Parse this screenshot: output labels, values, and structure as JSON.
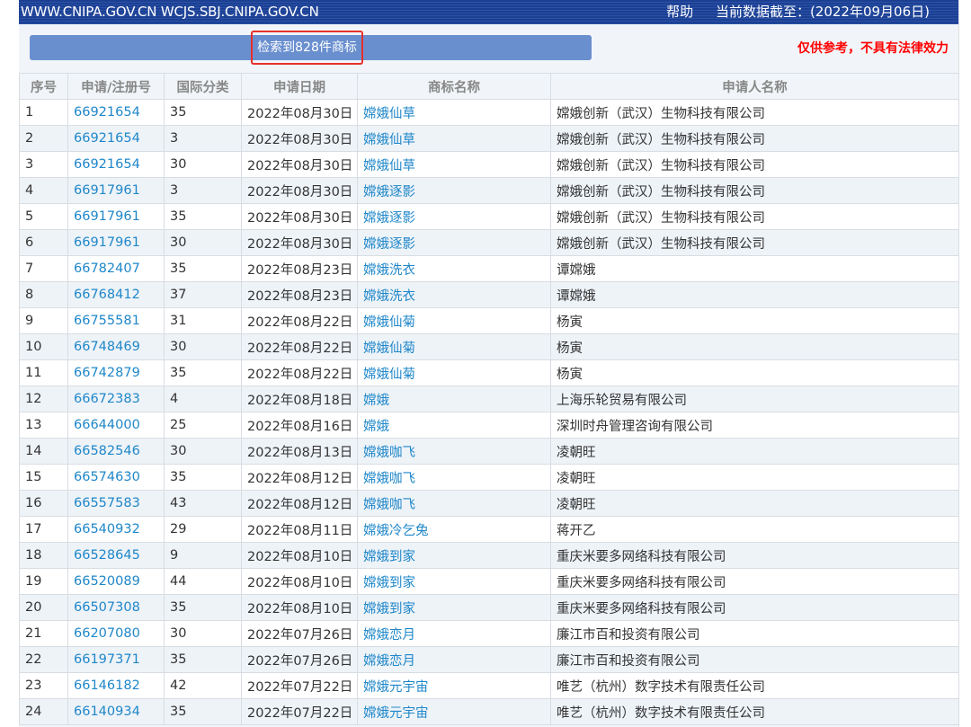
{
  "header": {
    "sites": "WWW.CNIPA.GOV.CN WCJS.SBJ.CNIPA.GOV.CN",
    "help": "帮助",
    "data_cutoff": "当前数据截至：(2022年09月06日)"
  },
  "search": {
    "result_count": "检索到828件商标",
    "disclaimer": "仅供参考，不具有法律效力"
  },
  "table": {
    "columns": [
      "序号",
      "申请/注册号",
      "国际分类",
      "申请日期",
      "商标名称",
      "申请人名称"
    ],
    "rows": [
      {
        "no": "1",
        "reg": "66921654",
        "cls": "35",
        "date": "2022年08月30日",
        "mark": "嫦娥仙草",
        "applicant": "嫦娥创新（武汉）生物科技有限公司"
      },
      {
        "no": "2",
        "reg": "66921654",
        "cls": "3",
        "date": "2022年08月30日",
        "mark": "嫦娥仙草",
        "applicant": "嫦娥创新（武汉）生物科技有限公司"
      },
      {
        "no": "3",
        "reg": "66921654",
        "cls": "30",
        "date": "2022年08月30日",
        "mark": "嫦娥仙草",
        "applicant": "嫦娥创新（武汉）生物科技有限公司"
      },
      {
        "no": "4",
        "reg": "66917961",
        "cls": "3",
        "date": "2022年08月30日",
        "mark": "嫦娥逐影",
        "applicant": "嫦娥创新（武汉）生物科技有限公司"
      },
      {
        "no": "5",
        "reg": "66917961",
        "cls": "35",
        "date": "2022年08月30日",
        "mark": "嫦娥逐影",
        "applicant": "嫦娥创新（武汉）生物科技有限公司"
      },
      {
        "no": "6",
        "reg": "66917961",
        "cls": "30",
        "date": "2022年08月30日",
        "mark": "嫦娥逐影",
        "applicant": "嫦娥创新（武汉）生物科技有限公司"
      },
      {
        "no": "7",
        "reg": "66782407",
        "cls": "35",
        "date": "2022年08月23日",
        "mark": "嫦娥洗衣",
        "applicant": "谭嫦娥"
      },
      {
        "no": "8",
        "reg": "66768412",
        "cls": "37",
        "date": "2022年08月23日",
        "mark": "嫦娥洗衣",
        "applicant": "谭嫦娥"
      },
      {
        "no": "9",
        "reg": "66755581",
        "cls": "31",
        "date": "2022年08月22日",
        "mark": "嫦娥仙菊",
        "applicant": "杨寅"
      },
      {
        "no": "10",
        "reg": "66748469",
        "cls": "30",
        "date": "2022年08月22日",
        "mark": "嫦娥仙菊",
        "applicant": "杨寅"
      },
      {
        "no": "11",
        "reg": "66742879",
        "cls": "35",
        "date": "2022年08月22日",
        "mark": "嫦娥仙菊",
        "applicant": "杨寅"
      },
      {
        "no": "12",
        "reg": "66672383",
        "cls": "4",
        "date": "2022年08月18日",
        "mark": "嫦娥",
        "applicant": "上海乐轮贸易有限公司"
      },
      {
        "no": "13",
        "reg": "66644000",
        "cls": "25",
        "date": "2022年08月16日",
        "mark": "嫦娥",
        "applicant": "深圳时舟管理咨询有限公司"
      },
      {
        "no": "14",
        "reg": "66582546",
        "cls": "30",
        "date": "2022年08月13日",
        "mark": "嫦娥咖飞",
        "applicant": "凌朝旺"
      },
      {
        "no": "15",
        "reg": "66574630",
        "cls": "35",
        "date": "2022年08月12日",
        "mark": "嫦娥咖飞",
        "applicant": "凌朝旺"
      },
      {
        "no": "16",
        "reg": "66557583",
        "cls": "43",
        "date": "2022年08月12日",
        "mark": "嫦娥咖飞",
        "applicant": "凌朝旺"
      },
      {
        "no": "17",
        "reg": "66540932",
        "cls": "29",
        "date": "2022年08月11日",
        "mark": "嫦娥冷乞兔",
        "applicant": "蒋开乙"
      },
      {
        "no": "18",
        "reg": "66528645",
        "cls": "9",
        "date": "2022年08月10日",
        "mark": "嫦娥到家",
        "applicant": "重庆米要多网络科技有限公司"
      },
      {
        "no": "19",
        "reg": "66520089",
        "cls": "44",
        "date": "2022年08月10日",
        "mark": "嫦娥到家",
        "applicant": "重庆米要多网络科技有限公司"
      },
      {
        "no": "20",
        "reg": "66507308",
        "cls": "35",
        "date": "2022年08月10日",
        "mark": "嫦娥到家",
        "applicant": "重庆米要多网络科技有限公司"
      },
      {
        "no": "21",
        "reg": "66207080",
        "cls": "30",
        "date": "2022年07月26日",
        "mark": "嫦娥恋月",
        "applicant": "廉江市百和投资有限公司"
      },
      {
        "no": "22",
        "reg": "66197371",
        "cls": "35",
        "date": "2022年07月26日",
        "mark": "嫦娥恋月",
        "applicant": "廉江市百和投资有限公司"
      },
      {
        "no": "23",
        "reg": "66146182",
        "cls": "42",
        "date": "2022年07月22日",
        "mark": "嫦娥元宇宙",
        "applicant": "唯艺（杭州）数字技术有限责任公司"
      },
      {
        "no": "24",
        "reg": "66140934",
        "cls": "35",
        "date": "2022年07月22日",
        "mark": "嫦娥元宇宙",
        "applicant": "唯艺（杭州）数字技术有限责任公司"
      }
    ]
  }
}
